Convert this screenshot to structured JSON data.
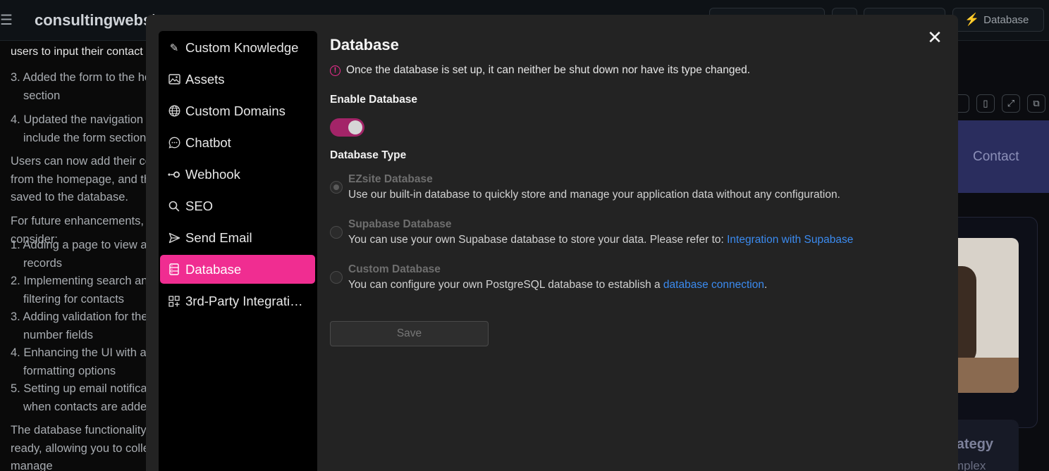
{
  "app": {
    "title": "consultingwebsite"
  },
  "topbar": {
    "database_label": "Database"
  },
  "chat": {
    "line0": "users to input their contact",
    "list_a": [
      {
        "num": "3.",
        "text": "Added the form to the homepage section"
      },
      {
        "num": "4.",
        "text": "Updated the navigation to include the form section"
      }
    ],
    "para1": "Users can now add their contacts from the homepage, and they'll be saved to the database.",
    "para2": "For future enhancements, consider:",
    "list_b": [
      {
        "num": "1.",
        "text": "Adding a page to view all contact records"
      },
      {
        "num": "2.",
        "text": "Implementing search and filtering for contacts"
      },
      {
        "num": "3.",
        "text": "Adding validation for the phone number fields"
      },
      {
        "num": "4.",
        "text": "Enhancing the UI with additional formatting options"
      },
      {
        "num": "5.",
        "text": "Setting up email notifications when contacts are added"
      }
    ],
    "para3": "The database functionality is now ready, allowing you to collect and manage"
  },
  "preview": {
    "contact": "Contact",
    "strategy": "rategy",
    "strategy_sub": "mplex"
  },
  "sidebar": {
    "items": [
      {
        "label": "Custom Knowledge",
        "icon": "pencil-icon"
      },
      {
        "label": "Assets",
        "icon": "image-icon"
      },
      {
        "label": "Custom Domains",
        "icon": "globe-icon"
      },
      {
        "label": "Chatbot",
        "icon": "chat-bubble-icon"
      },
      {
        "label": "Webhook",
        "icon": "webhook-icon"
      },
      {
        "label": "SEO",
        "icon": "search-icon"
      },
      {
        "label": "Send Email",
        "icon": "send-icon"
      },
      {
        "label": "Database",
        "icon": "database-icon"
      },
      {
        "label": "3rd-Party Integrations",
        "icon": "grid-icon"
      }
    ],
    "active_index": 7
  },
  "main": {
    "title": "Database",
    "warning": "Once the database is set up, it can neither be shut down nor have its type changed.",
    "enable_label": "Enable Database",
    "enable_on": true,
    "type_label": "Database Type",
    "options": [
      {
        "title": "EZsite Database",
        "desc": "Use our built-in database to quickly store and manage your application data without any configuration.",
        "checked": true
      },
      {
        "title": "Supabase Database",
        "desc": "You can use your own Supabase database to store your data. Please refer to: ",
        "link": "Integration with Supabase",
        "checked": false
      },
      {
        "title": "Custom Database",
        "desc": "You can configure your own PostgreSQL database to establish a ",
        "link": "database connection",
        "after": ".",
        "checked": false
      }
    ],
    "save_label": "Save"
  },
  "colors": {
    "accent": "#f02d91",
    "toggle_on": "#a32468",
    "link": "#3b8bf0"
  }
}
